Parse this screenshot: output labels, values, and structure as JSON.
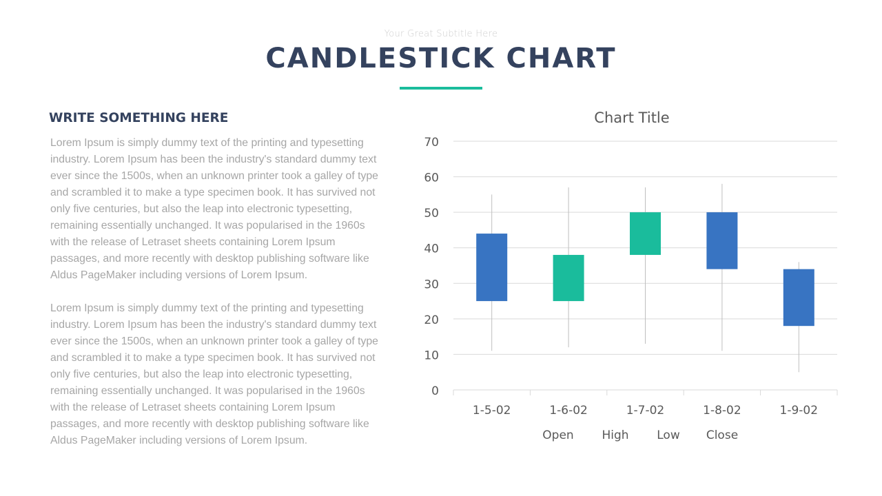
{
  "slide": {
    "subtitle": "Your Great Subtitle Here",
    "title": "CANDLESTICK CHART",
    "accent_color": "#1ABC9C",
    "title_color": "#34425E"
  },
  "content": {
    "heading": "WRITE SOMETHING HERE",
    "paragraphs": [
      {
        "lines": [
          "Lorem Ipsum  is simply dummy  text of the printing and typesetting",
          "industry.  Lorem Ipsum  has been the industry's  standard dummy  text",
          "ever since the  1500s, when  an unknown  printer took a galley  of type",
          "and scrambled it to make a type  specimen book. It has survived  not",
          "only  five centuries,  but also the leap into electronic typesetting,",
          "remaining essentially  unchanged.  It was popularised in the 1960s",
          "with the release of Letraset sheets  containing  Lorem Ipsum",
          "passages, and more recently  with desktop publishing software  like",
          "Aldus PageMaker including versions  of Lorem Ipsum."
        ]
      },
      {
        "lines": [
          "Lorem Ipsum  is simply dummy  text of the printing and typesetting",
          "industry.  Lorem Ipsum  has been the industry's  standard dummy  text",
          "ever since the  1500s, when  an unknown  printer took a galley  of type",
          "and scrambled it to make a type  specimen book. It has survived  not",
          "only  five centuries,  but also the leap into electronic typesetting,",
          "remaining essentially  unchanged.  It was popularised in the 1960s",
          "with the release of Letraset sheets  containing  Lorem Ipsum",
          "passages, and more recently  with desktop publishing software  like",
          "Aldus PageMaker including versions  of Lorem Ipsum."
        ]
      }
    ]
  },
  "chart_data": {
    "type": "candlestick",
    "title": "Chart Title",
    "xlabel": "",
    "ylabel": "",
    "categories": [
      "1-5-02",
      "1-6-02",
      "1-7-02",
      "1-8-02",
      "1-9-02"
    ],
    "series": [
      {
        "name": "Open",
        "values": [
          44,
          25,
          38,
          50,
          34
        ]
      },
      {
        "name": "High",
        "values": [
          55,
          57,
          57,
          58,
          36
        ]
      },
      {
        "name": "Low",
        "values": [
          11,
          12,
          13,
          11,
          5
        ]
      },
      {
        "name": "Close",
        "values": [
          25,
          38,
          50,
          34,
          18
        ]
      }
    ],
    "ylim": [
      0,
      70
    ],
    "yticks": [
      0,
      10,
      20,
      30,
      40,
      50,
      60,
      70
    ],
    "grid": true,
    "legend": {
      "entries": [
        "Open",
        "High",
        "Low",
        "Close"
      ],
      "placement": "bottom"
    },
    "colors": {
      "up": "#1ABC9C",
      "down": "#3874C2",
      "wick": "#bfbfbf",
      "grid": "#d9d9d9"
    }
  }
}
